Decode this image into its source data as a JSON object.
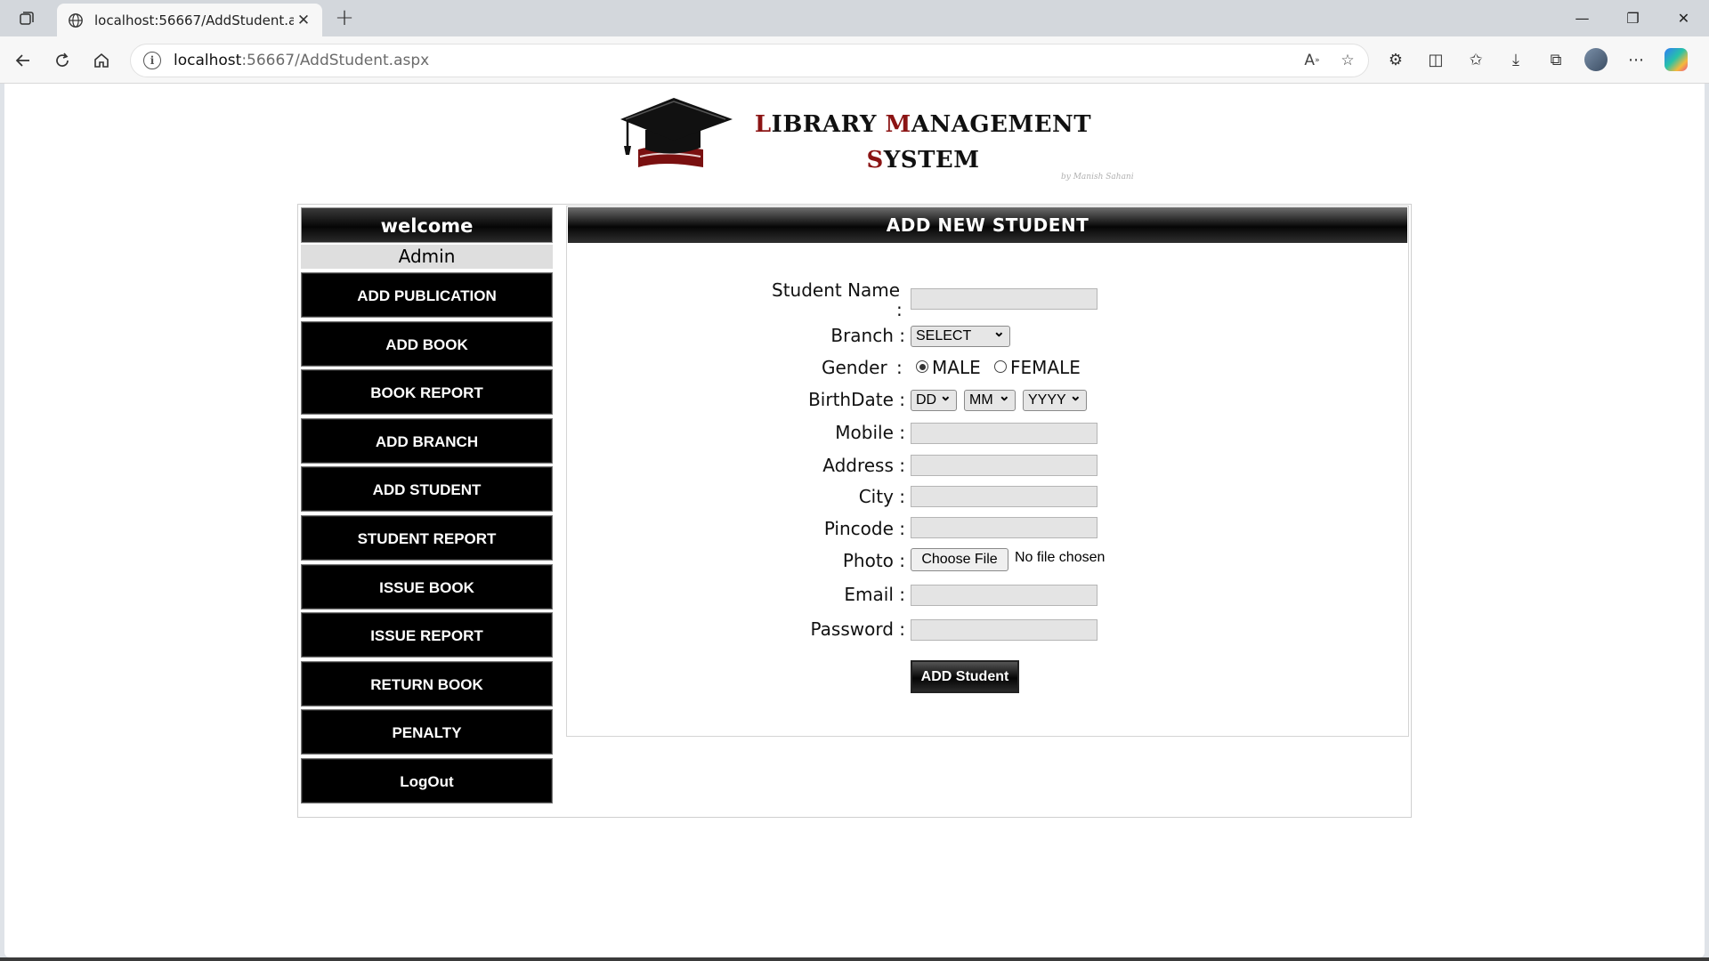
{
  "browser": {
    "tab_title": "localhost:56667/AddStudent.aspx",
    "url_host": "localhost",
    "url_path": ":56667/AddStudent.aspx"
  },
  "header": {
    "title_line1": "Library Management",
    "title_line2": "System",
    "byline": "by Manish Sahani"
  },
  "sidebar": {
    "welcome": "welcome",
    "user": "Admin",
    "items": [
      {
        "label": "ADD PUBLICATION"
      },
      {
        "label": "ADD BOOK"
      },
      {
        "label": "BOOK REPORT"
      },
      {
        "label": "ADD BRANCH"
      },
      {
        "label": "ADD STUDENT"
      },
      {
        "label": "STUDENT REPORT"
      },
      {
        "label": "ISSUE BOOK"
      },
      {
        "label": "ISSUE REPORT"
      },
      {
        "label": "RETURN BOOK"
      },
      {
        "label": "PENALTY"
      },
      {
        "label": "LogOut"
      }
    ]
  },
  "form": {
    "heading": "ADD NEW STUDENT",
    "student_name_label": "Student Name",
    "colon": ":",
    "branch_label": "Branch :",
    "branch_value": "SELECT",
    "gender_label": "Gender",
    "gender_male": "MALE",
    "gender_female": "FEMALE",
    "gender_selected": "MALE",
    "birthdate_label": "BirthDate :",
    "dd": "DD",
    "mm": "MM",
    "yyyy": "YYYY",
    "mobile_label": "Mobile :",
    "address_label": "Address :",
    "city_label": "City :",
    "pincode_label": "Pincode :",
    "photo_label": "Photo :",
    "choose_file": "Choose File",
    "no_file": "No file chosen",
    "email_label": "Email :",
    "password_label": "Password :",
    "submit_label": "ADD Student"
  }
}
